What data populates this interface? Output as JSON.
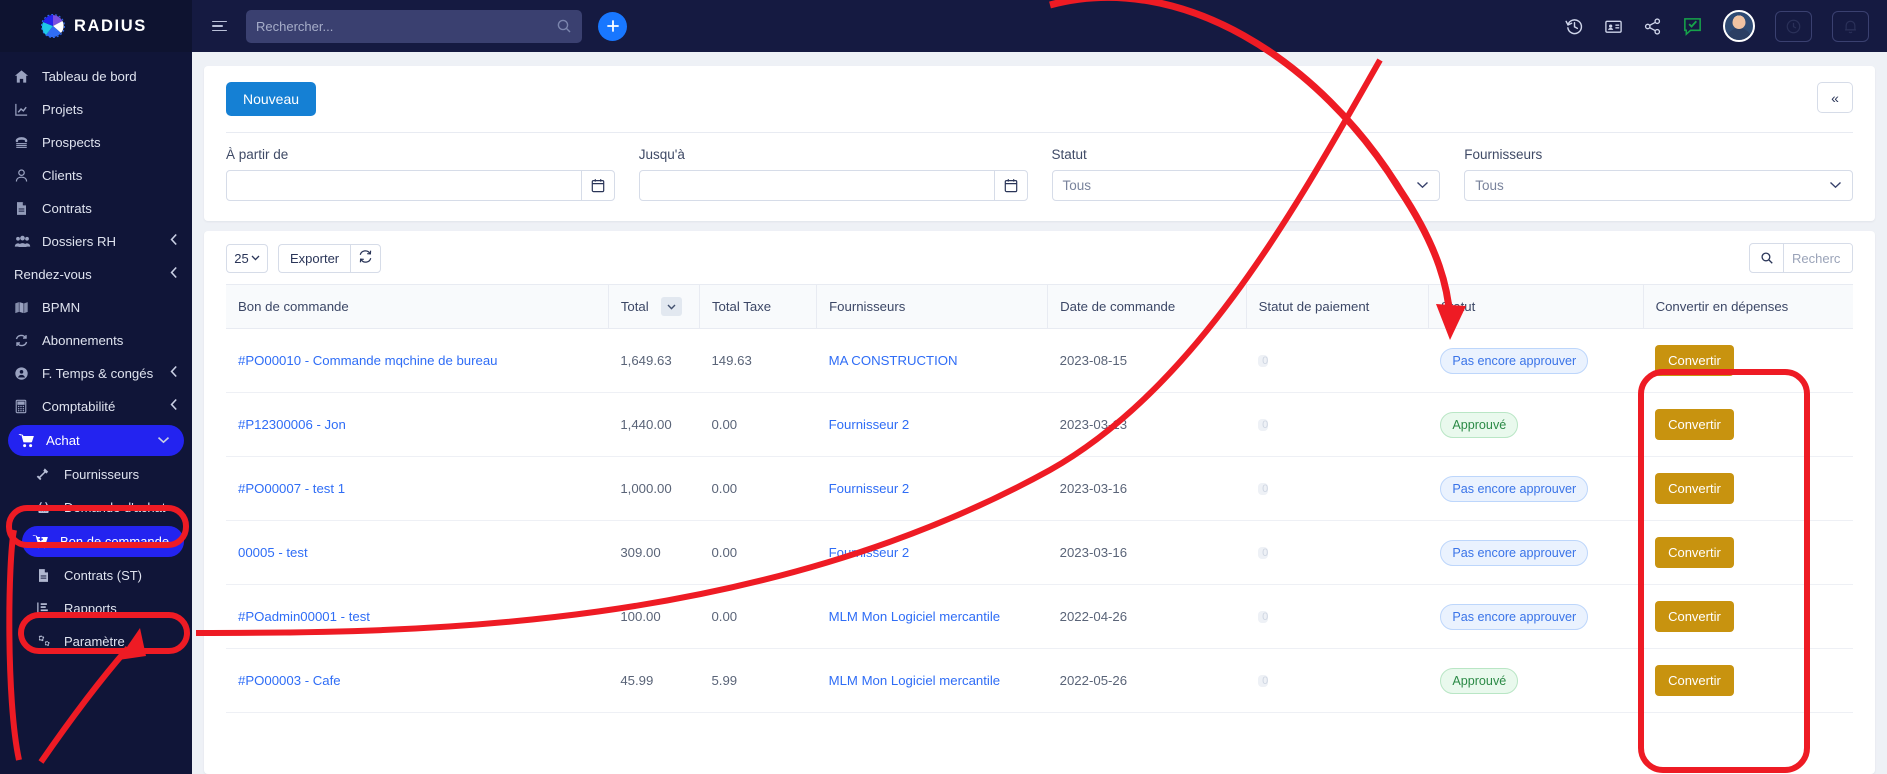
{
  "brand": {
    "name": "RADIUS",
    "logo_icon": "radius-logo-icon"
  },
  "topbar": {
    "menu_icon": "hamburger-icon",
    "search": {
      "placeholder": "Rechercher...",
      "value": "",
      "icon": "search-icon"
    },
    "add_button_label": "+",
    "icons": [
      "history-icon",
      "contact-card-icon",
      "share-icon",
      "chat-check-icon"
    ],
    "avatar_icon": "avatar",
    "right_buttons": [
      "clock-icon",
      "bell-icon"
    ]
  },
  "sidebar": {
    "items": [
      {
        "label": "Tableau de bord",
        "icon": "home-icon",
        "chevron": false,
        "sub": false,
        "active": false
      },
      {
        "label": "Projets",
        "icon": "chart-icon",
        "chevron": false,
        "sub": false,
        "active": false
      },
      {
        "label": "Prospects",
        "icon": "phone-icon",
        "chevron": false,
        "sub": false,
        "active": false
      },
      {
        "label": "Clients",
        "icon": "user-icon",
        "chevron": false,
        "sub": false,
        "active": false
      },
      {
        "label": "Contrats",
        "icon": "document-icon",
        "chevron": false,
        "sub": false,
        "active": false
      },
      {
        "label": "Dossiers RH",
        "icon": "users-icon",
        "chevron": true,
        "sub": false,
        "active": false
      },
      {
        "label": "Rendez-vous",
        "icon": "none",
        "chevron": true,
        "sub": false,
        "active": false
      },
      {
        "label": "BPMN",
        "icon": "map-icon",
        "chevron": false,
        "sub": false,
        "active": false
      },
      {
        "label": "Abonnements",
        "icon": "refresh-icon",
        "chevron": false,
        "sub": false,
        "active": false
      },
      {
        "label": "F. Temps & congés",
        "icon": "user-circle-icon",
        "chevron": true,
        "sub": false,
        "active": false
      },
      {
        "label": "Comptabilité",
        "icon": "calculator-icon",
        "chevron": true,
        "sub": false,
        "active": false
      },
      {
        "label": "Achat",
        "icon": "cart-icon",
        "chevron": true,
        "sub": false,
        "active": true
      },
      {
        "label": "Fournisseurs",
        "icon": "hammer-icon",
        "chevron": false,
        "sub": true,
        "active": false
      },
      {
        "label": "Demande d'achat",
        "icon": "basket-icon",
        "chevron": false,
        "sub": true,
        "active": false
      },
      {
        "label": "Bon de commande",
        "icon": "cart-plus-icon",
        "chevron": false,
        "sub": true,
        "active": true
      },
      {
        "label": "Contrats (ST)",
        "icon": "document-icon",
        "chevron": false,
        "sub": true,
        "active": false
      },
      {
        "label": "Rapports",
        "icon": "report-icon",
        "chevron": false,
        "sub": true,
        "active": false
      },
      {
        "label": "Paramètre",
        "icon": "gears-icon",
        "chevron": false,
        "sub": true,
        "active": false
      }
    ]
  },
  "page": {
    "new_button_label": "Nouveau",
    "collapse_icon": "«",
    "filters": {
      "from": {
        "label": "À partir de",
        "value": "",
        "placeholder": "",
        "calendar_icon": "calendar-icon"
      },
      "to": {
        "label": "Jusqu'à",
        "value": "",
        "placeholder": "",
        "calendar_icon": "calendar-icon"
      },
      "status": {
        "label": "Statut",
        "value": "Tous"
      },
      "suppliers": {
        "label": "Fournisseurs",
        "value": "Tous"
      }
    },
    "toolbar": {
      "page_size": "25",
      "export_label": "Exporter",
      "refresh_icon": "refresh-icon",
      "search": {
        "placeholder": "Recherc",
        "value": "",
        "icon": "search-icon"
      }
    },
    "table": {
      "columns": [
        "Bon de commande",
        "Total",
        "Total Taxe",
        "Fournisseurs",
        "Date de commande",
        "Statut de paiement",
        "Statut",
        "Convertir en dépenses"
      ],
      "sort_column": "Total",
      "payment_value": "0",
      "convert_label": "Convertir",
      "rows": [
        {
          "po": "#PO00010 - Commande mqchine de bureau",
          "total": "1,649.63",
          "tax": "149.63",
          "supplier": "MA CONSTRUCTION",
          "date": "2023-08-15",
          "payment": "0",
          "status": "Pas encore approuver",
          "status_type": "pending"
        },
        {
          "po": "#P12300006 - Jon",
          "total": "1,440.00",
          "tax": "0.00",
          "supplier": "Fournisseur 2",
          "date": "2023-03-13",
          "payment": "0",
          "status": "Approuvé",
          "status_type": "approved"
        },
        {
          "po": "#PO00007 - test 1",
          "total": "1,000.00",
          "tax": "0.00",
          "supplier": "Fournisseur 2",
          "date": "2023-03-16",
          "payment": "0",
          "status": "Pas encore approuver",
          "status_type": "pending"
        },
        {
          "po": "00005 - test",
          "total": "309.00",
          "tax": "0.00",
          "supplier": "Fournisseur 2",
          "date": "2023-03-16",
          "payment": "0",
          "status": "Pas encore approuver",
          "status_type": "pending"
        },
        {
          "po": "#POadmin00001 - test",
          "total": "100.00",
          "tax": "0.00",
          "supplier": "MLM Mon Logiciel mercantile",
          "date": "2022-04-26",
          "payment": "0",
          "status": "Pas encore approuver",
          "status_type": "pending"
        },
        {
          "po": "#PO00003 - Cafe",
          "total": "45.99",
          "tax": "5.99",
          "supplier": "MLM Mon Logiciel mercantile",
          "date": "2022-05-26",
          "payment": "0",
          "status": "Approuvé",
          "status_type": "approved"
        }
      ]
    }
  },
  "colors": {
    "sidebar_bg": "#101538",
    "topbar_bg": "#151a41",
    "accent_blue": "#1580d4",
    "active_nav": "#2323f0",
    "convert_gold": "#c8930f",
    "annotation_red": "#ee1b24",
    "link_blue": "#2f6df6"
  }
}
